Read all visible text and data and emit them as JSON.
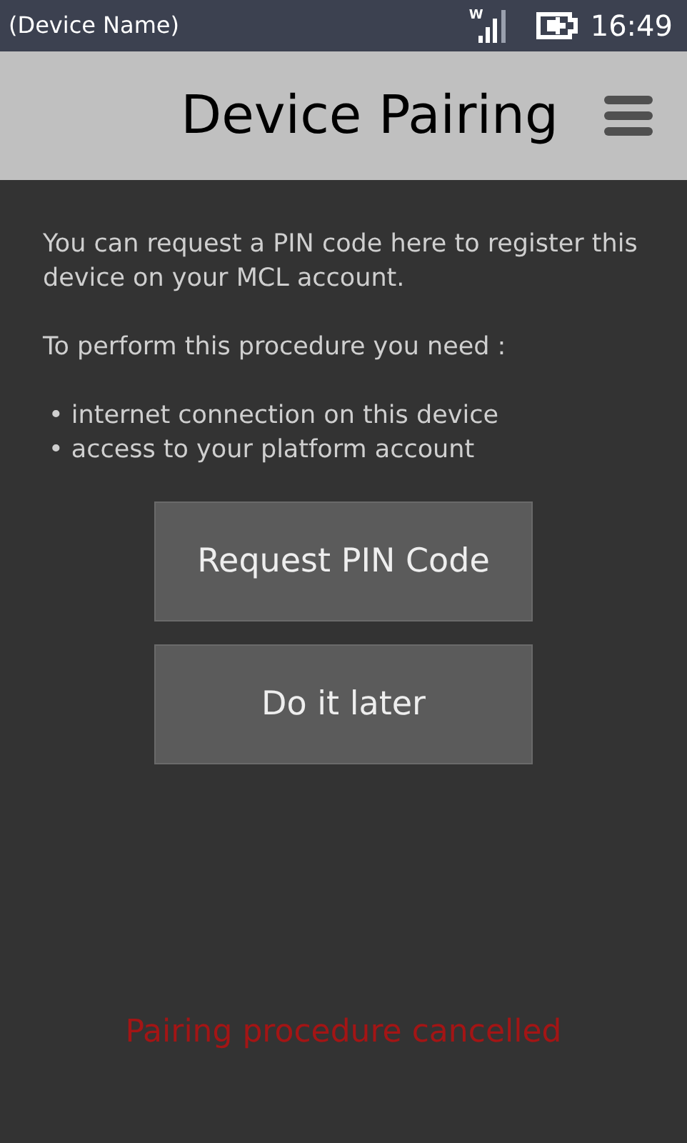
{
  "status_bar": {
    "device_name": "(Device Name)",
    "network_label": "W",
    "time": "16:49"
  },
  "header": {
    "title": "Device Pairing"
  },
  "intro": "You can request a PIN code here to register this device on your MCL account.",
  "requirements_heading": "To perform this procedure you need :",
  "requirements": [
    "• internet connection on this device",
    "• access to your platform account"
  ],
  "buttons": [
    "Request PIN Code",
    "Do it later"
  ],
  "status_message": "Pairing procedure cancelled"
}
